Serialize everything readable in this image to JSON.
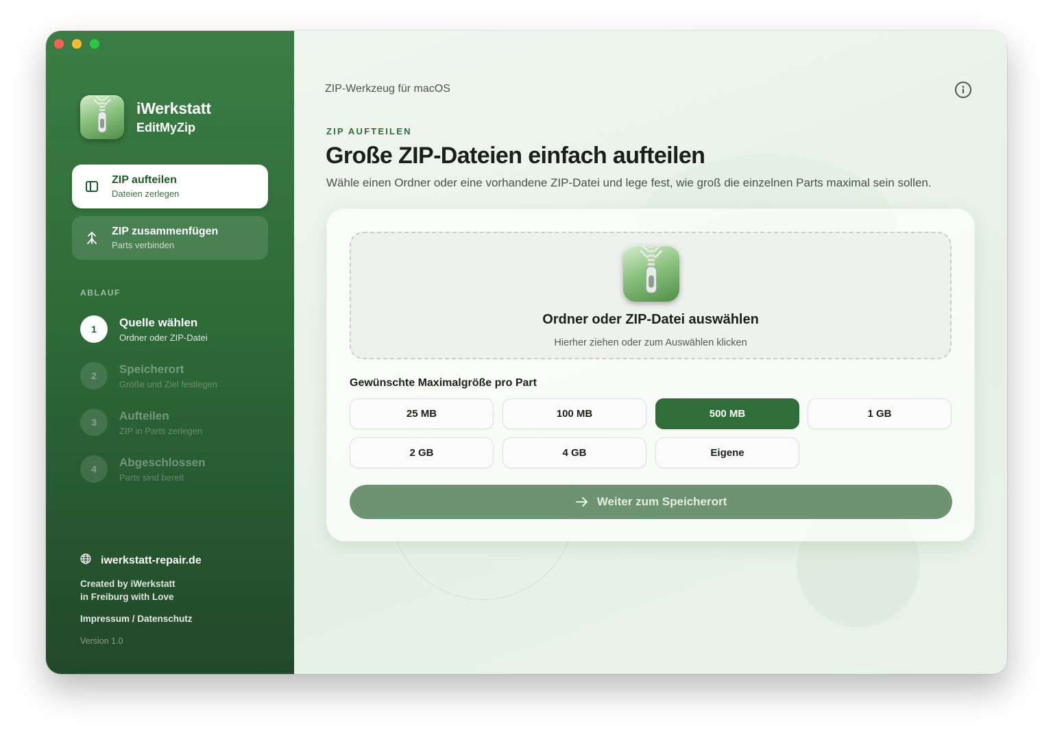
{
  "window": {
    "controls": [
      "close",
      "minimize",
      "zoom"
    ]
  },
  "brand": {
    "name": "iWerkstatt",
    "product": "EditMyZip",
    "icon": "zip-app-icon"
  },
  "nav": [
    {
      "title": "ZIP aufteilen",
      "subtitle": "Dateien zerlegen",
      "icon": "split-icon",
      "active": true
    },
    {
      "title": "ZIP zusammenfügen",
      "subtitle": "Parts verbinden",
      "icon": "merge-icon",
      "active": false
    }
  ],
  "steps_label": "ABLAUF",
  "steps": [
    {
      "num": "1",
      "title": "Quelle wählen",
      "subtitle": "Ordner oder ZIP-Datei",
      "active": true
    },
    {
      "num": "2",
      "title": "Speicherort",
      "subtitle": "Größe und Ziel festlegen",
      "active": false
    },
    {
      "num": "3",
      "title": "Aufteilen",
      "subtitle": "ZIP in Parts zerlegen",
      "active": false
    },
    {
      "num": "4",
      "title": "Abgeschlossen",
      "subtitle": "Parts sind bereit",
      "active": false
    }
  ],
  "footer": {
    "website": "iwerkstatt-repair.de",
    "created_line1": "Created by iWerkstatt",
    "created_line2": "in Freiburg with Love",
    "legal": "Impressum / Datenschutz",
    "version": "Version 1.0"
  },
  "main": {
    "topline": "ZIP-Werkzeug für macOS",
    "kicker": "ZIP AUFTEILEN",
    "headline": "Große ZIP-Dateien einfach aufteilen",
    "lead": "Wähle einen Ordner oder eine vorhandene ZIP-Datei und lege fest, wie groß die einzelnen Parts maximal sein sollen.",
    "drop_title": "Ordner oder ZIP-Datei auswählen",
    "drop_subtitle": "Hierher ziehen oder zum Auswählen klicken",
    "size_label": "Gewünschte Maximalgröße pro Part",
    "sizes": [
      "25 MB",
      "100 MB",
      "500 MB",
      "1 GB",
      "2 GB",
      "4 GB",
      "Eigene"
    ],
    "selected_size": "500 MB",
    "continue_label": "Weiter zum Speicherort"
  },
  "colors": {
    "accent": "#2f6d39",
    "sidebar_top": "#3b7d45",
    "sidebar_bottom": "#22482a",
    "disabled_button": "#6d9370"
  }
}
